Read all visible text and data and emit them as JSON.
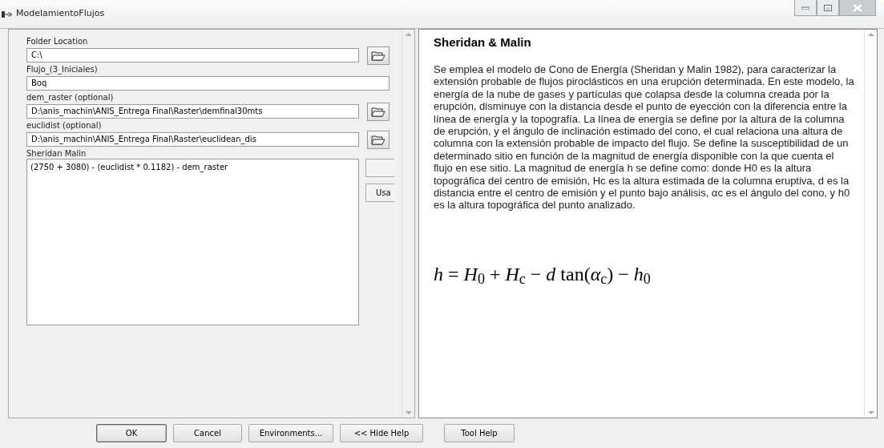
{
  "window": {
    "title": "ModelamientoFlujos"
  },
  "parameters": [
    {
      "label": "Folder Location",
      "value": "C:\\",
      "browse": true
    },
    {
      "label": "Flujo_(3_Iniciales)",
      "value": "Boq",
      "browse": false
    },
    {
      "label": "dem_raster (optional)",
      "value": "D:\\anis_machin\\ANIS_Entrega Final\\Raster\\demfinal30mts",
      "browse": true
    },
    {
      "label": "euclidist (optional)",
      "value": "D:\\anis_machin\\ANIS_Entrega Final\\Raster\\euclidean_dis",
      "browse": true
    }
  ],
  "expression": {
    "label": "Sheridan  Malin",
    "value": "(2750 + 3080) - (euclidist * 0.1182) - dem_raster",
    "side_button": "Usa"
  },
  "help": {
    "title": "Sheridan & Malin",
    "body": "Se emplea el modelo de Cono de Energía (Sheridan y Malin 1982), para caracterizar la extensión probable de flujos piroclásticos en una erupción determinada. En este modelo, la energía de la nube de gases y partículas que colapsa desde la columna creada por la erupción, disminuye con la distancia desde el punto de eyección con la diferencia entre la línea de energía y la topografía. La línea de energía se define por la altura de la columna de erupción, y el ángulo de inclinación estimado del cono, el cual relaciona una altura de columna con la extensión probable de impacto del flujo. Se define la susceptibilidad de un determinado sitio en función de la magnitud de energía disponible con la que cuenta el flujo en ese sitio. La magnitud de energía h se define como: donde H0 es la altura topográfica del centro de emisión, Hc es la altura estimada de la columna eruptiva, d es la distancia entre el centro de emisión y el punto bajo análisis, αc es el ángulo del cono, y h0 es la altura topográfica del punto analizado.",
    "formula": "*h* = *H*$_{0}$ + *H*$_{c}$ − *d* tan(*α*$_{c}$) − *h*$_{0}$"
  },
  "buttons": [
    {
      "label": "OK",
      "default": true
    },
    {
      "label": "Cancel",
      "default": false
    },
    {
      "label": "Environments...",
      "default": false
    },
    {
      "label": "<< Hide Help",
      "default": false
    },
    {
      "label": "Tool Help",
      "default": false
    }
  ]
}
